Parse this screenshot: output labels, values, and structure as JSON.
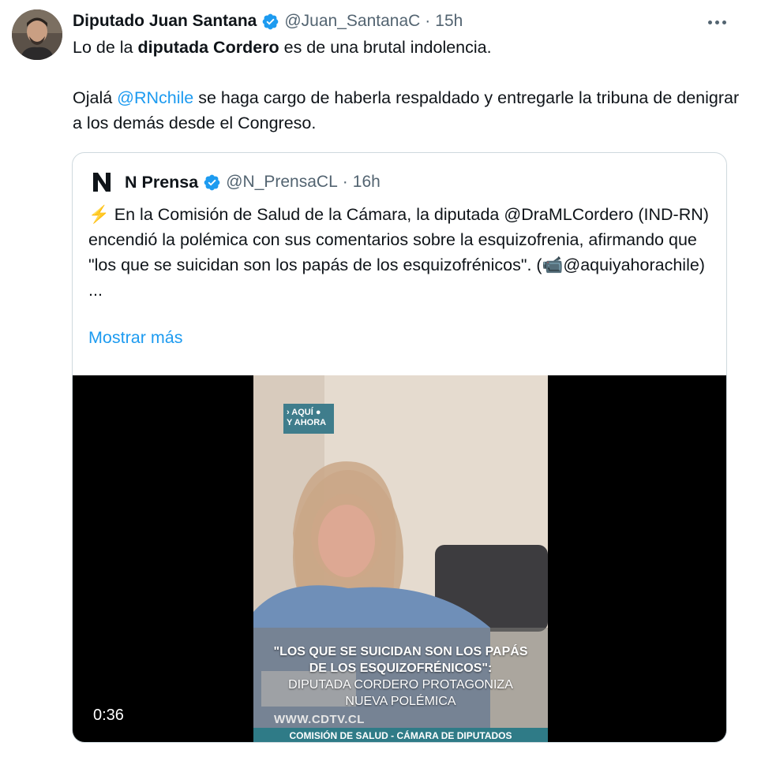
{
  "tweet": {
    "author_name": "Diputado Juan Santana",
    "handle": "@Juan_SantanaC",
    "separator": "·",
    "time": "15h",
    "line1_pre": "Lo de la ",
    "line1_bold": "diputada Cordero",
    "line1_post": " es de una brutal indolencia.",
    "line2_pre": "Ojalá ",
    "line2_mention": "@RNchile",
    "line2_post": " se haga cargo de haberla respaldado y entregarle la tribuna de denigrar a los demás desde el Congreso."
  },
  "quote": {
    "author_name": "N Prensa",
    "handle": "@N_PrensaCL",
    "separator": "·",
    "time": "16h",
    "emoji": "⚡",
    "body": "En la Comisión de Salud de la Cámara, la diputada @DraMLCordero (IND-RN) encendió la polémica con sus comentarios sobre la esquizofrenia, afirmando que \"los que se suicidan son los papás de los esquizofrénicos\". (",
    "camera_emoji": "📹",
    "body_tail": "@aquiyahorachile)",
    "ellipsis": "...",
    "show_more": "Mostrar más"
  },
  "video": {
    "duration": "0:36",
    "badge_line1": "› AQUÍ ●",
    "badge_line2": "Y AHORA",
    "caption_bold_1": "\"LOS QUE SE SUICIDAN SON LOS PAPÁS",
    "caption_bold_2": "DE LOS ESQUIZOFRÉNICOS\":",
    "caption_line3": "DIPUTADA CORDERO PROTAGONIZA",
    "caption_line4": "NUEVA POLÉMICA",
    "website": "WWW.CDTV.CL",
    "bottom_bar": "COMISIÓN DE SALUD - CÁMARA DE DIPUTADOS"
  },
  "colors": {
    "accent": "#1d9bf0",
    "text": "#0f1419",
    "muted": "#536471",
    "border": "#cfd9de"
  },
  "icons": [
    "avatar",
    "verified-badge-icon",
    "more-options-icon",
    "n-prensa-logo"
  ]
}
